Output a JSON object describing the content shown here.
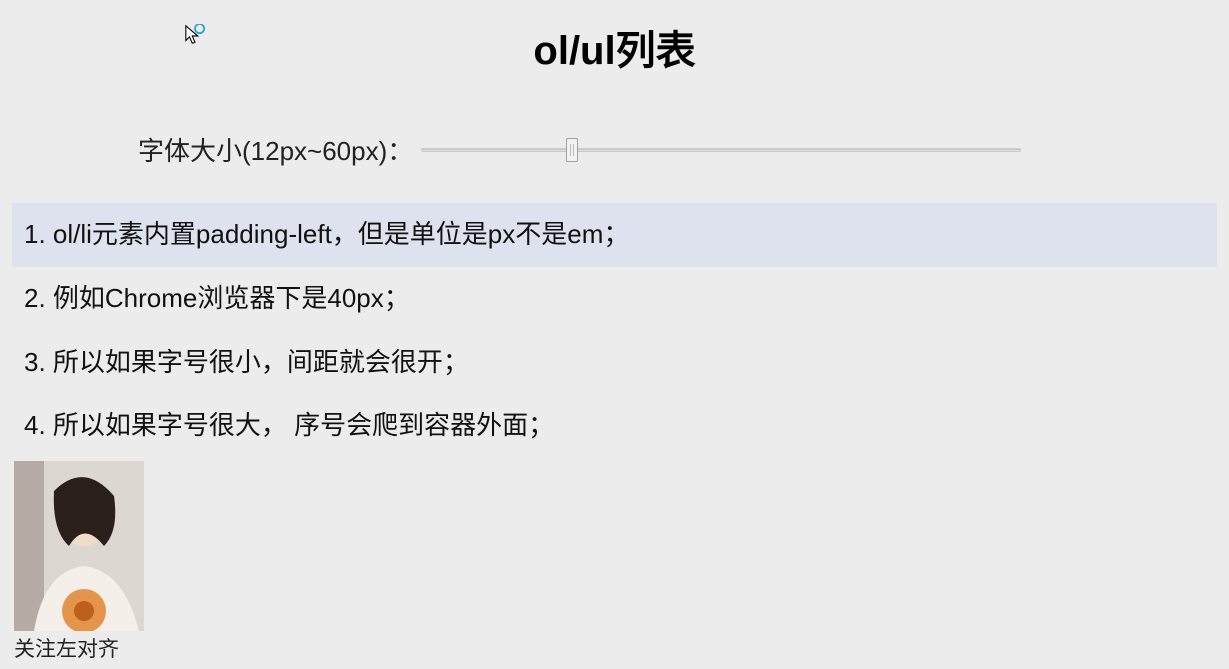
{
  "title": "ol/ul列表",
  "sliderLabel": "字体大小(12px~60px)：",
  "items": [
    "1. ol/li元素内置padding-left，但是单位是px不是em；",
    "2. 例如Chrome浏览器下是40px；",
    "3. 所以如果字号很小，间距就会很开；",
    "4. 所以如果字号很大， 序号会爬到容器外面；"
  ],
  "caption": "关注左对齐"
}
